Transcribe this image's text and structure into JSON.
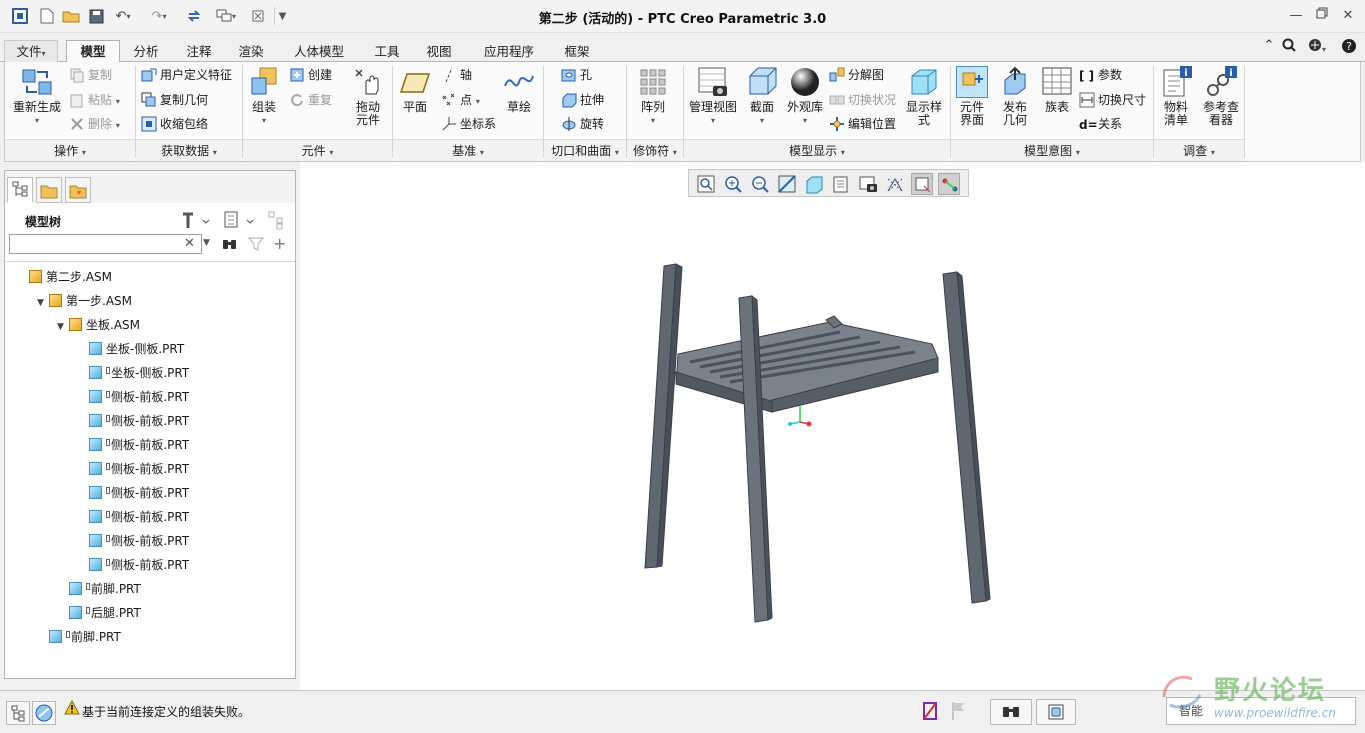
{
  "window": {
    "title": "第二步 (活动的) - PTC Creo Parametric 3.0",
    "quick_access_icons": [
      "app-icon",
      "new-icon",
      "open-icon",
      "save-icon",
      "undo-icon",
      "redo-icon",
      "regenerate-icon",
      "windows-icon",
      "close-window-icon",
      "customize-icon"
    ]
  },
  "tabs": [
    {
      "label": "文件",
      "caret": "▾"
    },
    {
      "label": "模型"
    },
    {
      "label": "分析"
    },
    {
      "label": "注释"
    },
    {
      "label": "渲染"
    },
    {
      "label": "人体模型"
    },
    {
      "label": "工具"
    },
    {
      "label": "视图"
    },
    {
      "label": "应用程序"
    },
    {
      "label": "框架"
    }
  ],
  "ribbon": {
    "groups": [
      {
        "label": "操作"
      },
      {
        "label": "获取数据"
      },
      {
        "label": "元件"
      },
      {
        "label": "基准"
      },
      {
        "label": "切口和曲面"
      },
      {
        "label": "修饰符"
      },
      {
        "label": "模型显示"
      },
      {
        "label": "模型意图"
      },
      {
        "label": "调查"
      }
    ],
    "regenerate": "重新生成",
    "copy": "复制",
    "paste": "粘贴",
    "delete": "删除",
    "user_defined_feature": "用户定义特征",
    "copy_geometry": "复制几何",
    "shrinkwrap": "收缩包络",
    "assemble": "组装",
    "create": "创建",
    "repeat": "重复",
    "drag_components": "拖动\n元件",
    "plane": "平面",
    "axis": "轴",
    "point": "点",
    "csys": "坐标系",
    "sketch": "草绘",
    "hole": "孔",
    "extrude": "拉伸",
    "revolve": "旋转",
    "pattern": "阵列",
    "manage_views": "管理视图",
    "section": "截面",
    "appearance": "外观库",
    "exploded_view": "分解图",
    "toggle_status": "切换状况",
    "edit_position": "编辑位置",
    "display_style": "显示样\n式",
    "component_interface": "元件\n界面",
    "publish_geometry": "发布\n几何",
    "family_table": "族表",
    "parameters": "参数",
    "switch_dimensions": "切换尺寸",
    "relations": "关系",
    "bill_of_materials": "物料\n清单",
    "reference_viewer": "参考查\n看器"
  },
  "left_panel": {
    "title": "模型树",
    "search_placeholder": "",
    "tree": [
      {
        "label": "第二步.ASM",
        "type": "asm",
        "level": 0,
        "expander": ""
      },
      {
        "label": "第一步.ASM",
        "type": "asm",
        "level": 1,
        "expander": "▼"
      },
      {
        "label": "坐板.ASM",
        "type": "asm",
        "level": 2,
        "expander": "▼"
      },
      {
        "label": "坐板-侧板.PRT",
        "type": "prt",
        "level": 3,
        "expander": "",
        "flag": false
      },
      {
        "label": "坐板-侧板.PRT",
        "type": "prt",
        "level": 3,
        "expander": "",
        "flag": true
      },
      {
        "label": "侧板-前板.PRT",
        "type": "prt",
        "level": 3,
        "expander": "",
        "flag": true
      },
      {
        "label": "侧板-前板.PRT",
        "type": "prt",
        "level": 3,
        "expander": "",
        "flag": true
      },
      {
        "label": "侧板-前板.PRT",
        "type": "prt",
        "level": 3,
        "expander": "",
        "flag": true
      },
      {
        "label": "侧板-前板.PRT",
        "type": "prt",
        "level": 3,
        "expander": "",
        "flag": true
      },
      {
        "label": "侧板-前板.PRT",
        "type": "prt",
        "level": 3,
        "expander": "",
        "flag": true
      },
      {
        "label": "侧板-前板.PRT",
        "type": "prt",
        "level": 3,
        "expander": "",
        "flag": true
      },
      {
        "label": "侧板-前板.PRT",
        "type": "prt",
        "level": 3,
        "expander": "",
        "flag": true
      },
      {
        "label": "侧板-前板.PRT",
        "type": "prt",
        "level": 3,
        "expander": "",
        "flag": true
      },
      {
        "label": "前脚.PRT",
        "type": "prt",
        "level": 2,
        "expander": "",
        "flag": true
      },
      {
        "label": "后腿.PRT",
        "type": "prt",
        "level": 2,
        "expander": "",
        "flag": true
      },
      {
        "label": "前脚.PRT",
        "type": "prt",
        "level": 1,
        "expander": "",
        "flag": true
      }
    ]
  },
  "status": {
    "message": "基于当前连接定义的组装失败。",
    "filter_label": "智能"
  },
  "watermark": {
    "text": "野火论坛",
    "url": "www.proewildfire.cn"
  }
}
